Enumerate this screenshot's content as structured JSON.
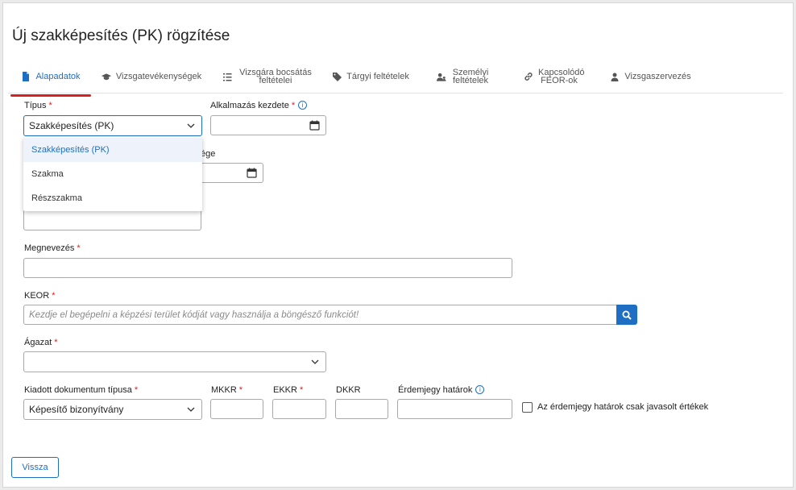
{
  "page": {
    "title": "Új szakképesítés (PK) rögzítése"
  },
  "tabs": [
    {
      "label": "Alapadatok",
      "icon": "document-icon"
    },
    {
      "label": "Vizsgatevékenységek",
      "icon": "graduation-cap-icon"
    },
    {
      "label": "Vizsgára bocsátás feltételei",
      "icon": "list-icon"
    },
    {
      "label": "Tárgyi feltételek",
      "icon": "tag-icon"
    },
    {
      "label": "Személyi feltételek",
      "icon": "user-group-icon"
    },
    {
      "label": "Kapcsolódó FEOR-ok",
      "icon": "link-icon"
    },
    {
      "label": "Vizsgaszervezés",
      "icon": "user-icon"
    }
  ],
  "form": {
    "tipus": {
      "label": "Típus",
      "value": "Szakképesítés (PK)"
    },
    "alkalmazas_kezdete": {
      "label": "Alkalmazás kezdete",
      "value": ""
    },
    "hidden_label_fragment": "ége",
    "megnevezes": {
      "label": "Megnevezés",
      "value": ""
    },
    "keor": {
      "label": "KEOR",
      "placeholder": "Kezdje el begépelni a képzési terület kódját vagy használja a böngésző funkciót!"
    },
    "agazat": {
      "label": "Ágazat",
      "value": ""
    },
    "kiadott_dokumentum": {
      "label": "Kiadott dokumentum típusa",
      "value": "Képesítő bizonyítvány"
    },
    "mkkr": {
      "label": "MKKR"
    },
    "ekkr": {
      "label": "EKKR"
    },
    "dkkr": {
      "label": "DKKR"
    },
    "erdemjegy": {
      "label": "Érdemjegy határok"
    },
    "checkbox_label": "Az érdemjegy határok csak javasolt értékek",
    "required_mark": "*",
    "info_mark": "i"
  },
  "dropdown": {
    "options": [
      "Szakképesítés (PK)",
      "Szakma",
      "Részszakma"
    ],
    "selected": "Szakképesítés (PK)"
  },
  "buttons": {
    "back": "Vissza"
  },
  "colors": {
    "accent": "#1e6fc4",
    "required": "#d9201e",
    "tab_underline": "#d9201e"
  }
}
